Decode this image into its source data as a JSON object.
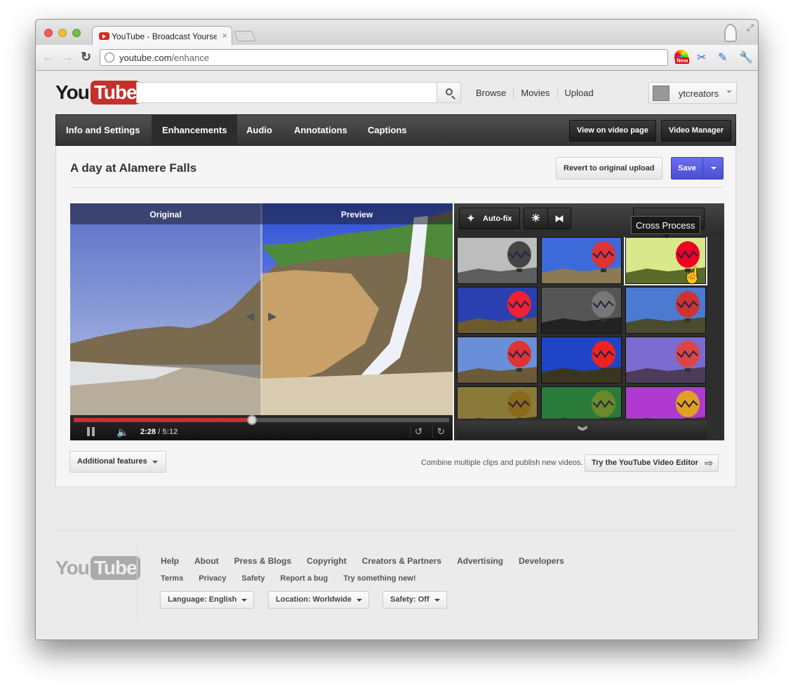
{
  "browser": {
    "tab_title": "YouTube - Broadcast Yourself",
    "tab_close": "×",
    "url_host": "youtube.com",
    "url_path": "/enhance",
    "new_badge": "New"
  },
  "header": {
    "logo_you": "You",
    "logo_tube": "Tube",
    "search_value": "",
    "links": [
      "Browse",
      "Movies",
      "Upload"
    ],
    "username": "ytcreators"
  },
  "menu": {
    "tabs": [
      {
        "label": "Info and Settings"
      },
      {
        "label": "Enhancements",
        "active": true
      },
      {
        "label": "Audio"
      },
      {
        "label": "Annotations"
      },
      {
        "label": "Captions"
      }
    ],
    "view_on_video_page": "View on video page",
    "video_manager": "Video Manager"
  },
  "editor": {
    "title": "A day at Alamere Falls",
    "revert_label": "Revert to original upload",
    "save_label": "Save",
    "original_label": "Original",
    "preview_label": "Preview",
    "current_time": "2:28",
    "total_time": "/ 5:12",
    "progress": 0.474,
    "autofix_label": "Auto-fix",
    "tooltip": "Cross Process",
    "filters_selected_index": 2
  },
  "footer_actions": {
    "additional_features": "Additional features",
    "combine_text": "Combine multiple clips and publish new videos.",
    "try_editor": "Try the YouTube Video Editor"
  },
  "footer": {
    "logo_you": "You",
    "logo_tube": "Tube",
    "links": [
      "Help",
      "About",
      "Press & Blogs",
      "Copyright",
      "Creators & Partners",
      "Advertising",
      "Developers"
    ],
    "links2": [
      "Terms",
      "Privacy",
      "Safety",
      "Report a bug",
      "Try something new!"
    ],
    "language": "Language: English",
    "location": "Location: Worldwide",
    "safety": "Safety: Off"
  },
  "colors": {
    "youtube_red": "#c4302b",
    "save_blue": "#5a5ee6",
    "menu_dark": "#333333"
  }
}
